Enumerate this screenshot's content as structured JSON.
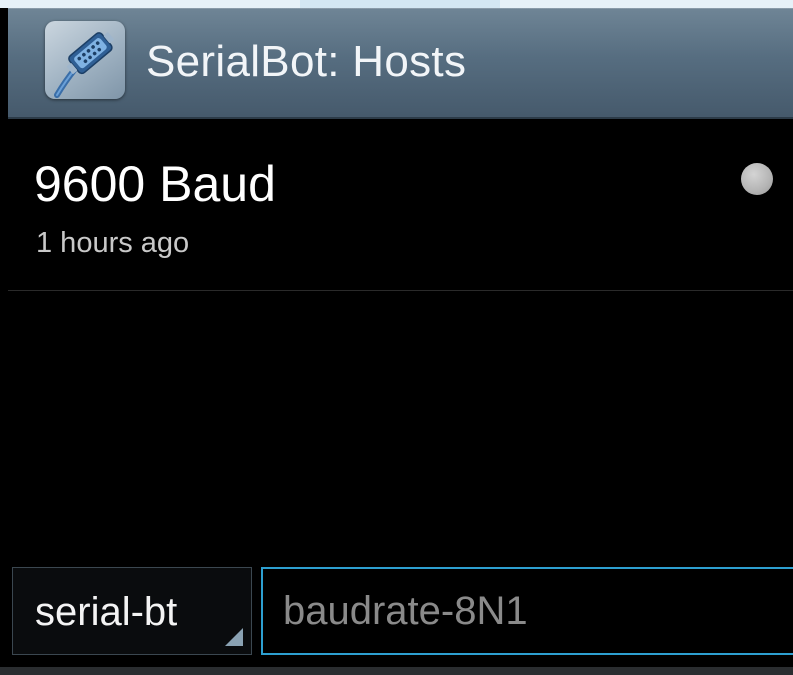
{
  "action_bar": {
    "title": "SerialBot: Hosts",
    "icon": "serial-connector-icon"
  },
  "hosts": [
    {
      "name": "9600 Baud",
      "last_connected": "1 hours ago",
      "status": "disconnected",
      "status_color": "#b4b4b4"
    }
  ],
  "quick_connect": {
    "protocol": "serial-bt",
    "input_value": "",
    "input_placeholder": "baudrate-8N1"
  },
  "colors": {
    "action_bar": "#566d80",
    "input_focus": "#2d9fd0",
    "background": "#000000"
  }
}
